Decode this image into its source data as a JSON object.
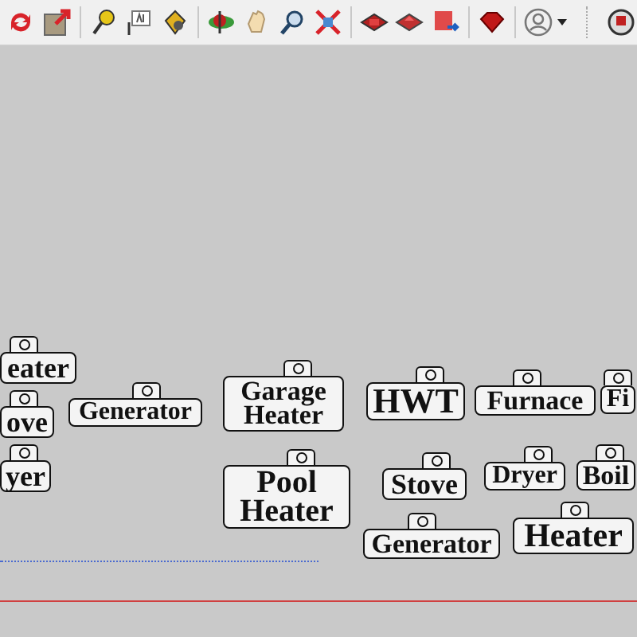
{
  "tags": [
    {
      "text": "eater"
    },
    {
      "text": "ove"
    },
    {
      "text": "yer"
    },
    {
      "text": "Generator"
    },
    {
      "text": "Garage Heater"
    },
    {
      "text": "HWT"
    },
    {
      "text": "Furnace"
    },
    {
      "text": "Fi"
    },
    {
      "text": "Pool Heater"
    },
    {
      "text": "Stove"
    },
    {
      "text": "Dryer"
    },
    {
      "text": "Boil"
    },
    {
      "text": "Generator"
    },
    {
      "text": "Heater"
    }
  ]
}
